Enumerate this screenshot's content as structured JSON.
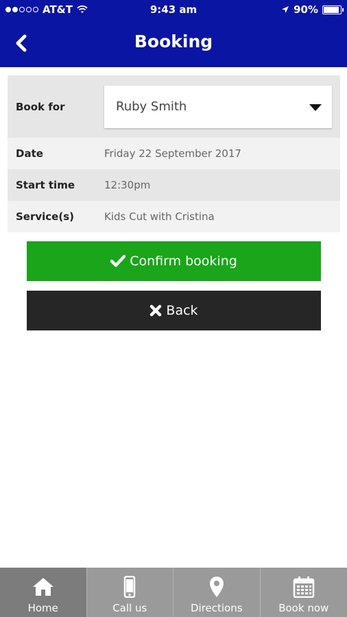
{
  "status_bar": {
    "carrier": "AT&T",
    "time": "9:43 am",
    "battery": "90%",
    "battery_level": 0.9,
    "signal_bars_filled": 2,
    "signal_bars_total": 5
  },
  "nav": {
    "title": "Booking",
    "back_icon": "chevron-left-icon"
  },
  "details": {
    "book_for_label": "Book for",
    "book_for_value": "Ruby Smith",
    "date_label": "Date",
    "date_value": "Friday 22 September 2017",
    "start_time_label": "Start time",
    "start_time_value": "12:30pm",
    "services_label": "Service(s)",
    "services_value": "Kids Cut with Cristina"
  },
  "buttons": {
    "confirm_label": "Confirm booking",
    "confirm_icon": "check-icon",
    "back_label": "Back",
    "back_icon": "close-icon"
  },
  "tabs": [
    {
      "label": "Home",
      "icon": "home-icon",
      "active": true
    },
    {
      "label": "Call us",
      "icon": "phone-icon",
      "active": false
    },
    {
      "label": "Directions",
      "icon": "map-pin-icon",
      "active": false
    },
    {
      "label": "Book now",
      "icon": "calendar-icon",
      "active": false
    }
  ],
  "colors": {
    "header": "#0a15a3",
    "confirm": "#1aa51a",
    "back": "#262626",
    "tab_bg": "#9a9a9a",
    "tab_active": "#7c7c7c"
  }
}
